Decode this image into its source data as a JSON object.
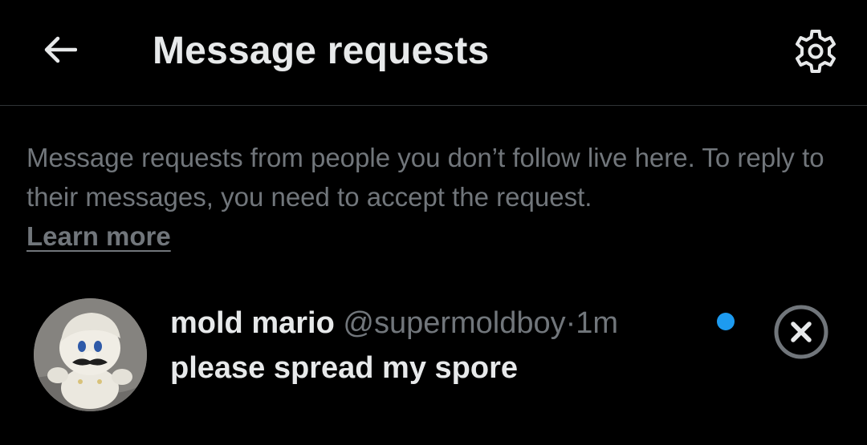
{
  "header": {
    "title": "Message requests",
    "back_icon": "arrow-left-icon",
    "settings_icon": "gear-icon"
  },
  "info": {
    "text": "Message requests from people you don’t follow live here. To reply to their messages, you need to accept the request.",
    "learn_more": "Learn more"
  },
  "requests": [
    {
      "name": "mold mario",
      "handle": "@supermoldboy",
      "separator": "·",
      "time": "1m",
      "message": "please spread my spore",
      "unread": true,
      "avatar_icon": "plush-avatar",
      "dismiss_icon": "close-circle-icon"
    }
  ],
  "colors": {
    "background": "#000000",
    "primary_text": "#e7e9ea",
    "secondary_text": "#71767b",
    "divider": "#2f3336",
    "unread_dot": "#1d9bf0"
  }
}
